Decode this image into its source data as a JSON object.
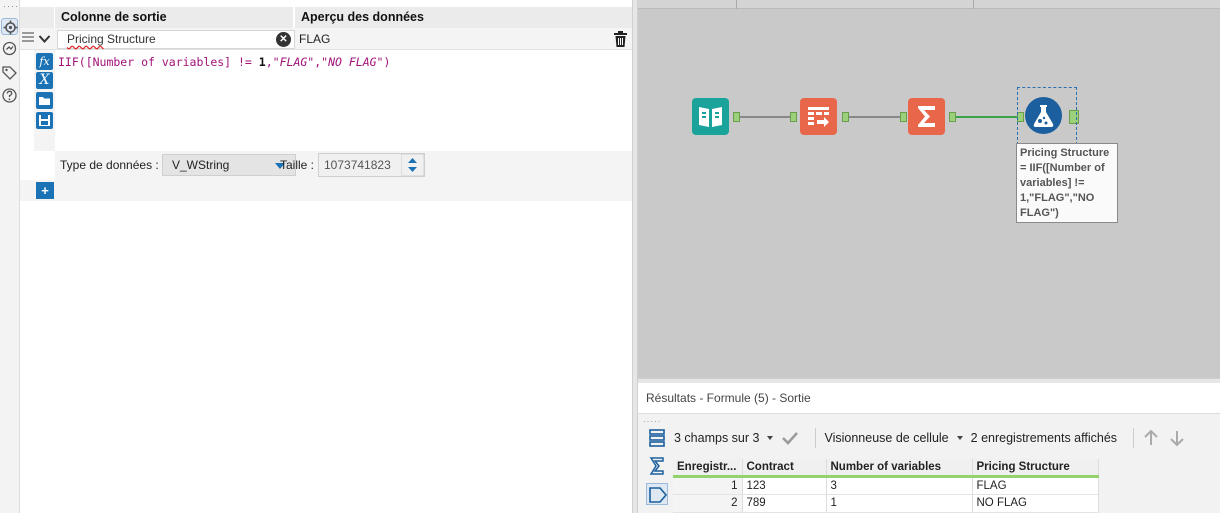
{
  "config": {
    "columns": {
      "output": "Colonne de sortie",
      "preview": "Aperçu des données"
    },
    "field_name": {
      "part1": "Pricing",
      "part2": " Structure"
    },
    "preview_value": "FLAG",
    "expression": {
      "t1": "IIF([Number of variables] != ",
      "num": "1",
      "t2": ",",
      "s1": "\"FLAG\"",
      "t3": ",",
      "s2": "\"NO FLAG\"",
      "t4": ")"
    },
    "tools": {
      "fx": "fx",
      "var": "X"
    },
    "type_label": "Type de données :",
    "type_value": "V_WString",
    "size_label": "Taille :",
    "size_value": "1073741823",
    "add_label": "+"
  },
  "canvas": {
    "annotation": "Pricing Structure = IIF([Number of variables] != 1,\"FLAG\",\"NO FLAG\")",
    "node_colors": {
      "input": "#1aa39a",
      "select": "#e8674a",
      "summarize": "#e8674a",
      "formula": "#1b5f9e"
    }
  },
  "results": {
    "title": "Résultats - Formule (5) - Sortie",
    "fields_selector": "3 champs sur 3",
    "cell_viewer": "Visionneuse de cellule",
    "records_shown": "2 enregistrements affichés",
    "table": {
      "headers": [
        "Enregistr...",
        "Contract",
        "Number of variables",
        "Pricing Structure"
      ],
      "rows": [
        [
          "1",
          "123",
          "3",
          "FLAG"
        ],
        [
          "2",
          "789",
          "1",
          "NO FLAG"
        ]
      ]
    }
  }
}
